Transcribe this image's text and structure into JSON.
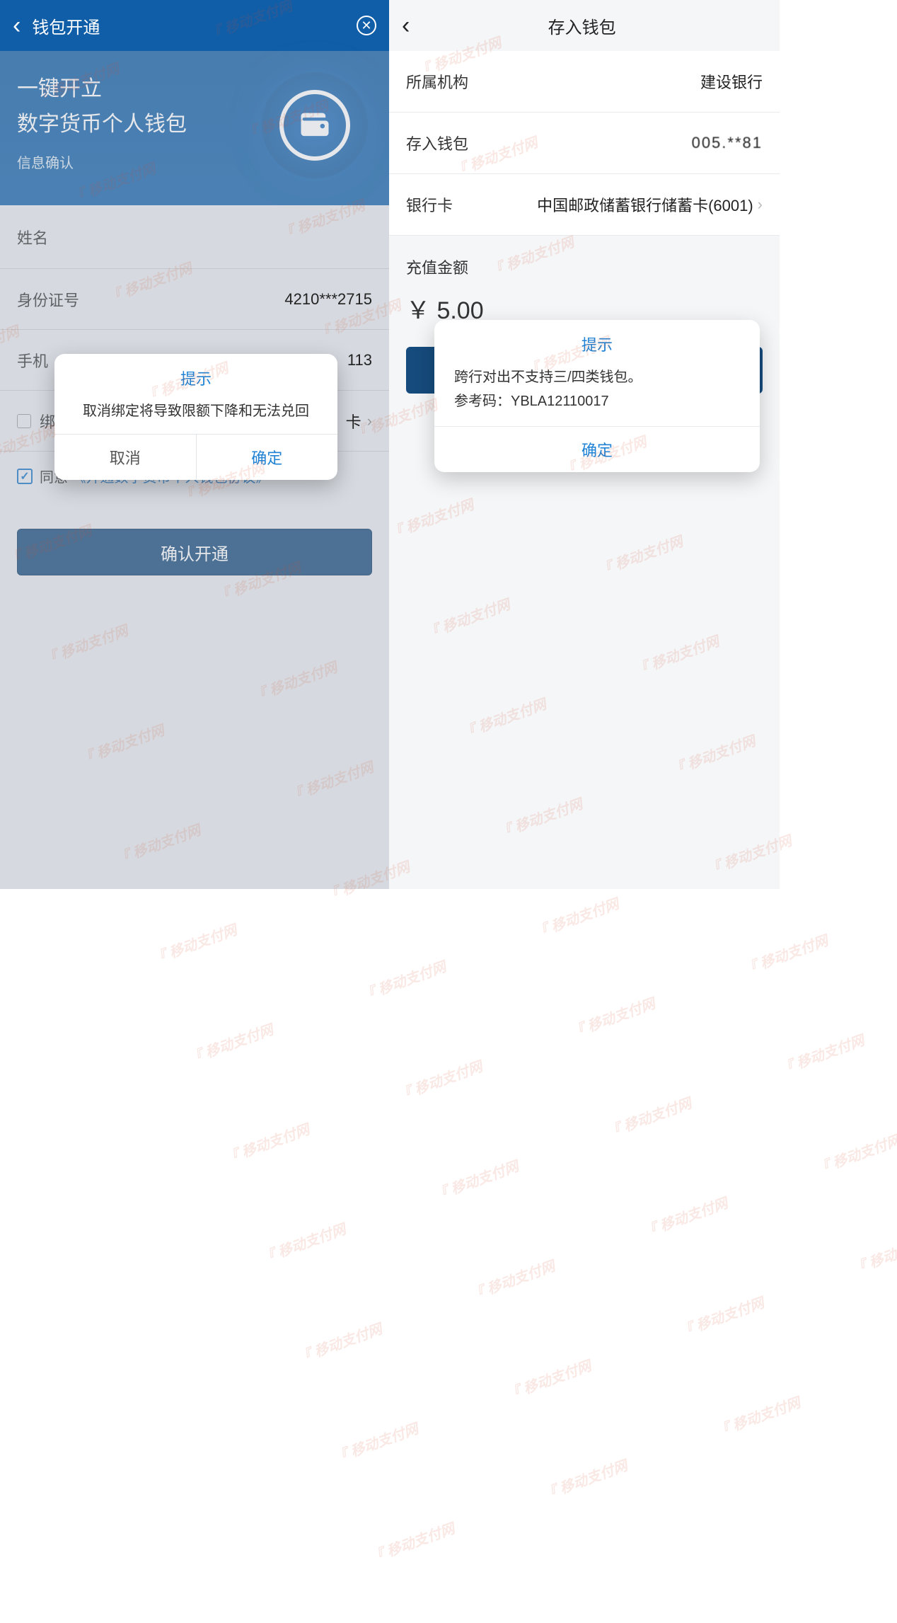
{
  "watermark": "移动支付网",
  "left": {
    "header": {
      "title": "钱包开通"
    },
    "hero": {
      "line1": "一键开立",
      "line2": "数字货币个人钱包",
      "sub": "信息确认"
    },
    "form": {
      "name_label": "姓名",
      "id_label": "身份证号",
      "id_value": "4210***2715",
      "phone_label": "手机",
      "phone_value": "113",
      "card_label": "绑…",
      "card_suffix": "卡",
      "agree_text": "同意",
      "agree_link": "《开通数字货币个人钱包协议》",
      "submit": "确认开通"
    },
    "dialog": {
      "title": "提示",
      "body": "取消绑定将导致限额下降和无法兑回",
      "cancel": "取消",
      "ok": "确定"
    }
  },
  "right": {
    "header": {
      "title": "存入钱包"
    },
    "rows": {
      "org_label": "所属机构",
      "org_value": "建设银行",
      "wallet_label": "存入钱包",
      "wallet_value": "005.**81 ",
      "card_label": "银行卡",
      "card_value": "中国邮政储蓄银行储蓄卡(6001)"
    },
    "amount": {
      "label": "充值金额",
      "value": "￥ 5.00"
    },
    "dialog": {
      "title": "提示",
      "line1": "跨行对出不支持三/四类钱包。",
      "line2": "参考码：YBLA12110017",
      "ok": "确定"
    }
  }
}
